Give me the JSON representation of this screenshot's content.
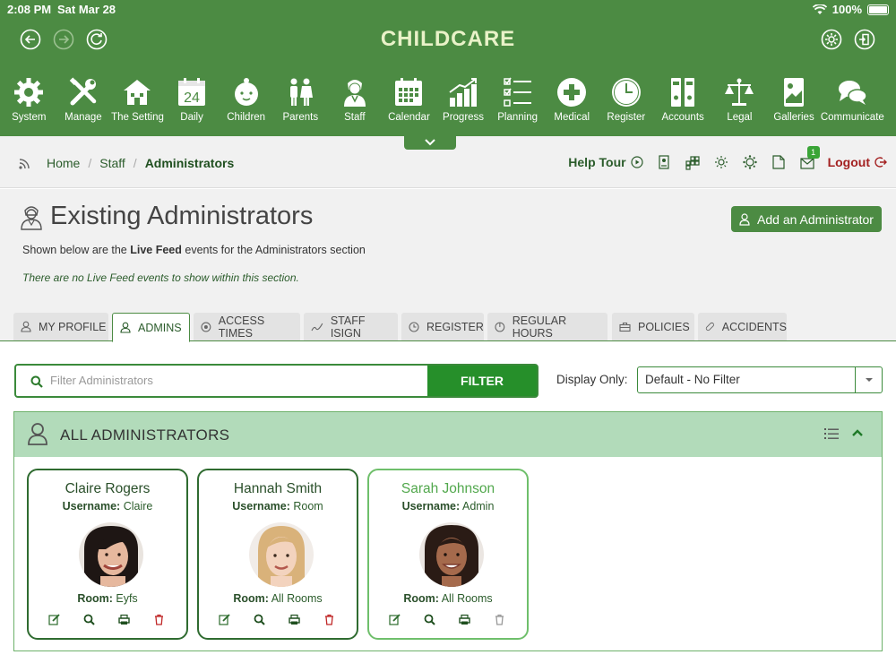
{
  "status_bar": {
    "time": "2:08 PM",
    "date": "Sat Mar 28",
    "battery": "100%"
  },
  "header": {
    "brand": "CHILDCARE"
  },
  "nav": [
    {
      "label": "System",
      "icon": "gear-icon"
    },
    {
      "label": "Manage",
      "icon": "tools-icon"
    },
    {
      "label": "The Setting",
      "icon": "house-icon"
    },
    {
      "label": "Daily",
      "icon": "calendar-day-icon",
      "number": "24"
    },
    {
      "label": "Children",
      "icon": "baby-icon"
    },
    {
      "label": "Parents",
      "icon": "parents-icon"
    },
    {
      "label": "Staff",
      "icon": "staff-icon"
    },
    {
      "label": "Calendar",
      "icon": "calendar-icon"
    },
    {
      "label": "Progress",
      "icon": "progress-chart-icon"
    },
    {
      "label": "Planning",
      "icon": "checklist-icon"
    },
    {
      "label": "Medical",
      "icon": "medical-cross-icon"
    },
    {
      "label": "Register",
      "icon": "clock-icon"
    },
    {
      "label": "Accounts",
      "icon": "binders-icon"
    },
    {
      "label": "Legal",
      "icon": "scales-icon"
    },
    {
      "label": "Galleries",
      "icon": "gallery-icon"
    },
    {
      "label": "Communicate",
      "icon": "chat-icon"
    }
  ],
  "breadcrumb": {
    "home": "Home",
    "staff": "Staff",
    "current": "Administrators"
  },
  "tools": {
    "help_tour": "Help Tour",
    "logout": "Logout",
    "message_count": "1"
  },
  "page": {
    "title": "Existing Administrators",
    "add_button": "Add an Administrator",
    "subtitle_prefix": "Shown below are the ",
    "subtitle_bold": "Live Feed",
    "subtitle_suffix": " events for the Administrators section",
    "no_feed": "There are no Live Feed events to show within this section."
  },
  "tabs": [
    {
      "label": "MY PROFILE",
      "icon": "person-icon"
    },
    {
      "label": "ADMINS",
      "icon": "admin-icon",
      "active": true
    },
    {
      "label": "ACCESS TIMES",
      "icon": "access-icon"
    },
    {
      "label": "STAFF ISIGN",
      "icon": "signature-icon"
    },
    {
      "label": "REGISTER",
      "icon": "clock-icon"
    },
    {
      "label": "REGULAR HOURS",
      "icon": "hours-icon"
    },
    {
      "label": "POLICIES",
      "icon": "briefcase-icon"
    },
    {
      "label": "ACCIDENTS",
      "icon": "bandage-icon"
    }
  ],
  "filter": {
    "placeholder": "Filter Administrators",
    "button": "FILTER",
    "display_label": "Display Only:",
    "display_value": "Default - No Filter"
  },
  "section": {
    "title": "ALL ADMINISTRATORS"
  },
  "admins": [
    {
      "name": "Claire Rogers",
      "username_label": "Username:",
      "username": "Claire",
      "room_label": "Room:",
      "room": "Eyfs"
    },
    {
      "name": "Hannah Smith",
      "username_label": "Username:",
      "username": "Room",
      "room_label": "Room:",
      "room": "All Rooms"
    },
    {
      "name": "Sarah Johnson",
      "username_label": "Username:",
      "username": "Admin",
      "room_label": "Room:",
      "room": "All Rooms"
    }
  ]
}
